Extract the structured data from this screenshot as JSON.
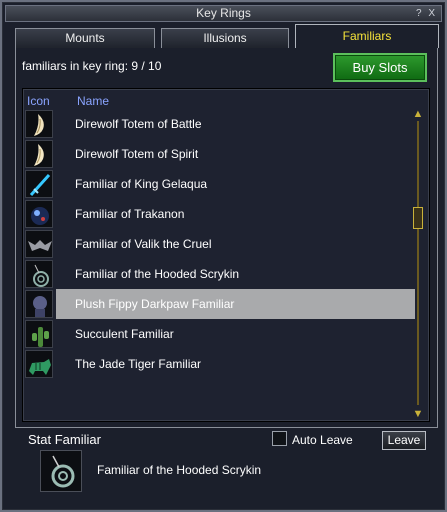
{
  "window": {
    "title": "Key Rings",
    "controls": [
      "?",
      "X"
    ]
  },
  "tabs": [
    {
      "label": "Mounts",
      "active": false
    },
    {
      "label": "Illusions",
      "active": false
    },
    {
      "label": "Familiars",
      "active": true
    }
  ],
  "count_text": "familiars in key ring: 9 / 10",
  "buy_slots_label": "Buy Slots",
  "list": {
    "headers": {
      "icon": "Icon",
      "name": "Name"
    },
    "items": [
      {
        "name": "Direwolf Totem of Battle",
        "icon": "fang-totem-icon"
      },
      {
        "name": "Direwolf Totem of Spirit",
        "icon": "fang-totem-icon"
      },
      {
        "name": "Familiar of King Gelaqua",
        "icon": "blue-sword-icon"
      },
      {
        "name": "Familiar of Trakanon",
        "icon": "orb-icon"
      },
      {
        "name": "Familiar of Valik the Cruel",
        "icon": "bat-wings-icon"
      },
      {
        "name": "Familiar of the Hooded Scrykin",
        "icon": "spiral-icon"
      },
      {
        "name": "Plush Fippy Darkpaw Familiar",
        "icon": "gnoll-icon"
      },
      {
        "name": "Succulent Familiar",
        "icon": "cactus-icon"
      },
      {
        "name": "The Jade Tiger Familiar",
        "icon": "tiger-icon"
      }
    ],
    "selected_index": 6
  },
  "stat": {
    "label": "Stat Familiar",
    "auto_leave_label": "Auto Leave",
    "auto_leave_checked": false,
    "leave_label": "Leave",
    "current_name": "Familiar of the Hooded Scrykin",
    "current_icon": "spiral-icon"
  },
  "colors": {
    "active_tab": "#f6e33a",
    "header": "#8aa4ff",
    "buy_button": "#1a7f1e",
    "selected_row": "#a9aaac"
  }
}
